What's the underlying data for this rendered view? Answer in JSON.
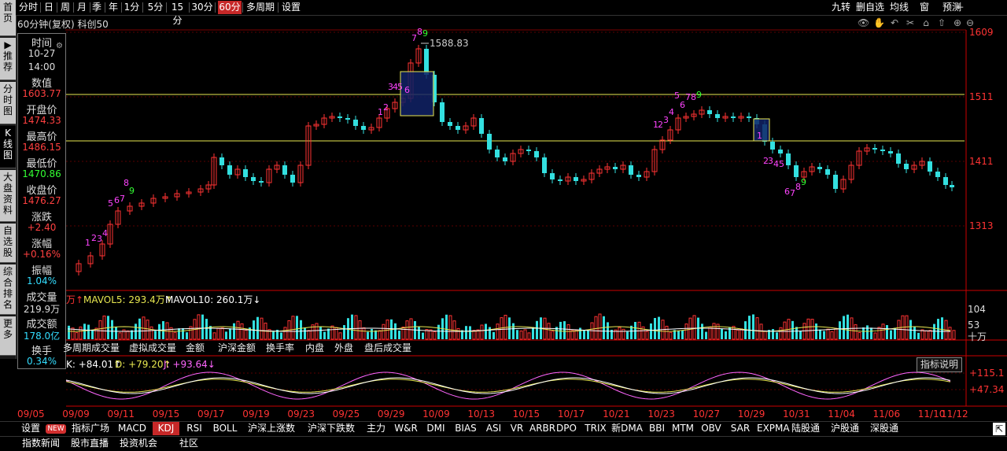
{
  "left_nav": [
    {
      "label": "首\n页",
      "active": false
    },
    {
      "label": "▶\n推\n荐",
      "active": false
    },
    {
      "label": "分\n时\n图",
      "active": false
    },
    {
      "label": "K\n线\n图",
      "active": true
    },
    {
      "label": "大\n盘\n资\n料",
      "active": false
    },
    {
      "label": "自\n选\n股",
      "active": false
    },
    {
      "label": "综\n合\n排\n名",
      "active": false
    },
    {
      "label": "更\n多",
      "active": false
    }
  ],
  "period_tabs": [
    "分时",
    "日",
    "周",
    "月",
    "季",
    "年",
    "1分",
    "5分",
    "15分",
    "30分",
    "60分",
    "多周期",
    "设置"
  ],
  "active_period": "60分",
  "right_tabs": [
    "九转",
    "删自选",
    "均线",
    "窗",
    "预测"
  ],
  "chart_title": "60分钟(复权) 科创50",
  "info": [
    {
      "label": "时间",
      "value": "10-27",
      "color": "#dddddd"
    },
    {
      "label": "",
      "value": "14:00",
      "color": "#dddddd"
    },
    {
      "label": "数值",
      "value": "1603.77",
      "color": "#ff4040"
    },
    {
      "label": "开盘价",
      "value": "1474.33",
      "color": "#ff4040"
    },
    {
      "label": "最高价",
      "value": "1486.15",
      "color": "#ff4040"
    },
    {
      "label": "最低价",
      "value": "1470.86",
      "color": "#33ff33"
    },
    {
      "label": "收盘价",
      "value": "1476.27",
      "color": "#ff4040"
    },
    {
      "label": "涨跌",
      "value": "+2.40",
      "color": "#ff4040"
    },
    {
      "label": "涨幅",
      "value": "+0.16%",
      "color": "#ff4040"
    },
    {
      "label": "振幅",
      "value": "1.04%",
      "color": "#33ddff"
    },
    {
      "label": "成交量",
      "value": "219.9万",
      "color": "#dddddd"
    },
    {
      "label": "成交额",
      "value": "178.0亿",
      "color": "#33ddff"
    },
    {
      "label": "换手",
      "value": "0.34%",
      "color": "#33ddff"
    }
  ],
  "price_axis": [
    "1609",
    "1511",
    "1411",
    "1313"
  ],
  "high_annotation": "1588.83",
  "volume_header": {
    "prefix": "万↑",
    "mavol5": "MAVOL5: 293.4万↑",
    "mavol10": "MAVOL10: 260.1万↓"
  },
  "volume_axis": [
    "104",
    "53",
    "十万"
  ],
  "volume_subtabs": [
    "多周期成交量",
    "虚拟成交量",
    "金额",
    "沪深金额",
    "换手率",
    "内盘",
    "外盘",
    "盘后成交量"
  ],
  "kdj_header": {
    "k": "K: +84.01↑",
    "d": "D: +79.20↑",
    "j": "J: +93.64↓"
  },
  "kdj_axis": [
    "+115.1",
    "+47.34"
  ],
  "kdj_help": "指标说明",
  "x_axis": [
    "09/05",
    "09/09",
    "09/11",
    "09/15",
    "09/17",
    "09/19",
    "09/23",
    "09/25",
    "09/29",
    "10/09",
    "10/13",
    "10/15",
    "10/17",
    "10/21",
    "10/23",
    "10/27",
    "10/29",
    "10/31",
    "11/04",
    "11/06",
    "11/10",
    "11/12"
  ],
  "indicator_tabs": [
    "设置",
    "NEW",
    "指标广场",
    "MACD",
    "KDJ",
    "RSI",
    "BOLL",
    "沪深上涨数",
    "沪深下跌数",
    "主力",
    "W&R",
    "DMI",
    "BIAS",
    "ASI",
    "VR",
    "ARBR",
    "DPO",
    "TRIX",
    "新DMA",
    "BBI",
    "MTM",
    "OBV",
    "SAR",
    "EXPMA",
    "陆股通",
    "沪股通",
    "深股通"
  ],
  "active_indicator": "KDJ",
  "footer_tabs": [
    "指数新闻",
    "股市直播",
    "投资机会",
    "社区"
  ],
  "colors": {
    "up": "#ff3333",
    "down": "#33e0e0",
    "grid": "#5a0000",
    "yellow": "#e8e850",
    "nine_seq": "#ff44ff"
  }
}
